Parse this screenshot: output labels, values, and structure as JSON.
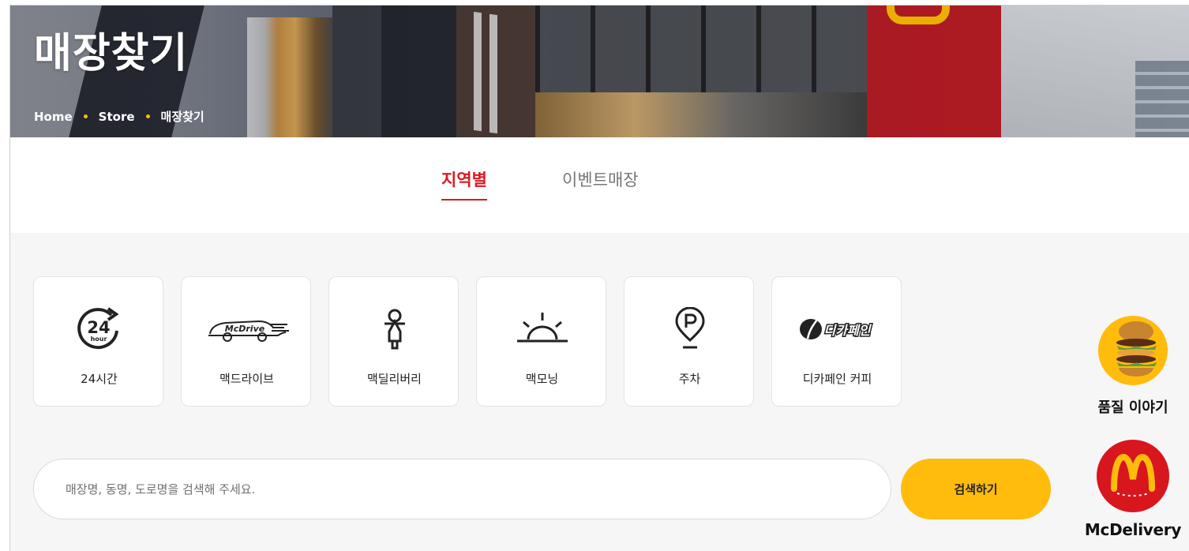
{
  "hero": {
    "title": "매장찾기",
    "breadcrumb": [
      "Home",
      "Store",
      "매장찾기"
    ]
  },
  "tabs": [
    {
      "label": "지역별",
      "active": true
    },
    {
      "label": "이벤트매장",
      "active": false
    }
  ],
  "filters": [
    {
      "label": "24시간",
      "icon": "24-hour-icon"
    },
    {
      "label": "맥드라이브",
      "icon": "mcdrive-car-icon"
    },
    {
      "label": "맥딜리버리",
      "icon": "delivery-scooter-icon"
    },
    {
      "label": "맥모닝",
      "icon": "sunrise-icon"
    },
    {
      "label": "주차",
      "icon": "parking-pin-icon"
    },
    {
      "label": "디카페인 커피",
      "icon": "decaf-logo-icon"
    }
  ],
  "icon_text": {
    "h24": "24",
    "hour": "hour",
    "mcdrive": "McDrive",
    "decaf": "디카페인"
  },
  "search": {
    "placeholder": "매장명, 동명, 도로명을 검색해 주세요.",
    "value": "",
    "button_label": "검색하기"
  },
  "side": {
    "quality_label": "품질 이야기",
    "delivery_label": "McDelivery"
  },
  "colors": {
    "brand_red": "#da1a22",
    "brand_yellow": "#ffbc0d"
  }
}
